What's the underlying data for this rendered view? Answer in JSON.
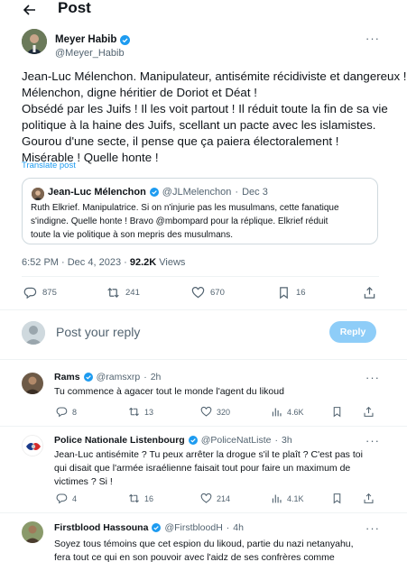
{
  "header": {
    "title": "Post"
  },
  "author": {
    "name": "Meyer Habib",
    "handle": "@Meyer_Habib"
  },
  "post": {
    "lines": [
      "Jean-Luc Mélenchon. Manipulateur, antisémite récidiviste et dangereux !",
      "Mélenchon, digne héritier de Doriot et Déat !",
      "Obsédé par les Juifs ! Il les voit partout ! Il réduit toute la fin de sa vie",
      "politique à la haine des Juifs, scellant un pacte avec les islamistes.",
      "Gourou d'une secte, il pense que ça paiera électoralement !",
      "Misérable ! Quelle honte !"
    ],
    "translate": "Translate post"
  },
  "quote": {
    "name": "Jean-Luc Mélenchon",
    "handle": "@JLMelenchon",
    "sep": "·",
    "date": "Dec 3",
    "lines": [
      "Ruth Elkrief. Manipulatrice. Si on n'injurie pas les musulmans, cette fanatique",
      "s'indigne. Quelle honte ! Bravo @mbompard pour la réplique. Elkrief réduit",
      "toute la vie politique à son mepris des musulmans."
    ]
  },
  "meta": {
    "time": "6:52 PM · Dec 4, 2023 · ",
    "views": "92.2K",
    "views_label": " Views"
  },
  "actions": {
    "replies": "875",
    "reposts": "241",
    "likes": "670",
    "bookmarks": "16"
  },
  "composer": {
    "placeholder": "Post your reply",
    "button": "Reply"
  },
  "replies": [
    {
      "name": "Rams",
      "handle": "@ramsxrp",
      "sep": "·",
      "time": "2h",
      "lines": [
        "Tu commence à agacer tout le monde l'agent du likoud"
      ],
      "stats": {
        "replies": "8",
        "reposts": "13",
        "likes": "320",
        "views": "4.6K"
      }
    },
    {
      "name": "Police Nationale Listenbourg",
      "handle": "@PoliceNatListe",
      "sep": "·",
      "time": "3h",
      "lines": [
        "Jean-Luc antisémite ? Tu peux arrêter la drogue s'il te plaît ? C'est pas toi",
        "qui disait que l'armée israélienne faisait tout pour faire un maximum de",
        "victimes ? Si !"
      ],
      "stats": {
        "replies": "4",
        "reposts": "16",
        "likes": "214",
        "views": "4.1K"
      }
    },
    {
      "name": "Firstblood Hassouna",
      "handle": "@FirstbloodH",
      "sep": "·",
      "time": "4h",
      "lines": [
        "Soyez tous témoins que cet espion du likoud, partie du nazi netanyahu,",
        "fera tout ce qui en son pouvoir avec l'aidz de ses confrères comme"
      ]
    }
  ],
  "colors": {
    "accent": "#1d9bf0",
    "verified": "#1d9bf0",
    "muted": "#536471",
    "reply_button": "#8ecdf8"
  }
}
